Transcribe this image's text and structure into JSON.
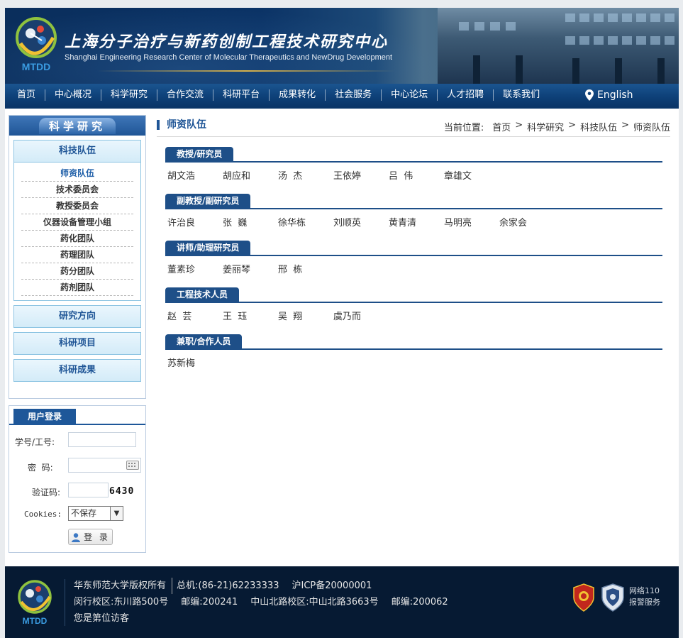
{
  "header": {
    "logo_text": "MTDD",
    "title_cn": "上海分子治疗与新药创制工程技术研究中心",
    "title_en": "Shanghai Engineering Research Center of Molecular Therapeutics and NewDrug Development"
  },
  "nav": {
    "items": [
      "首页",
      "中心概况",
      "科学研究",
      "合作交流",
      "科研平台",
      "成果转化",
      "社会服务",
      "中心论坛",
      "人才招聘",
      "联系我们"
    ],
    "english_label": "English"
  },
  "sidebar": {
    "heading": "科学研究",
    "categories": [
      {
        "label": "科技队伍"
      },
      {
        "label": "研究方向"
      },
      {
        "label": "科研项目"
      },
      {
        "label": "科研成果"
      }
    ],
    "subitems": [
      "师资队伍",
      "技术委员会",
      "教授委员会",
      "仪器设备管理小组",
      "药化团队",
      "药理团队",
      "药分团队",
      "药剂团队"
    ],
    "active_subitem": "师资队伍"
  },
  "login": {
    "tab_label": "用户登录",
    "username_label": "学号/工号:",
    "password_label": "密  码:",
    "captcha_label": "验证码:",
    "captcha_value": "6430",
    "cookies_label": "Cookies:",
    "cookies_selected": "不保存",
    "submit_label": "登 录"
  },
  "main": {
    "title": "师资队伍",
    "breadcrumb": {
      "prefix": "当前位置:",
      "items": [
        "首页",
        "科学研究",
        "科技队伍",
        "师资队伍"
      ],
      "separator": ">"
    },
    "sections": [
      {
        "title": "教授/研究员",
        "names": [
          "胡文浩",
          "胡应和",
          "汤  杰",
          "王依婷",
          "吕  伟",
          "章雄文"
        ]
      },
      {
        "title": "副教授/副研究员",
        "names": [
          "许治良",
          "张  巍",
          "徐华栋",
          "刘顺英",
          "黄青清",
          "马明亮",
          "余家会"
        ]
      },
      {
        "title": "讲师/助理研究员",
        "names": [
          "董素珍",
          "姜丽琴",
          "邢  栋"
        ]
      },
      {
        "title": "工程技术人员",
        "names": [
          "赵  芸",
          "王  珏",
          "吴  翔",
          "虞乃而"
        ]
      },
      {
        "title": "兼职/合作人员",
        "names": [
          "苏新梅"
        ]
      }
    ]
  },
  "footer": {
    "logo_text": "MTDD",
    "copyright": "华东师范大学版权所有",
    "phone": "总机:(86-21)62233333",
    "icp": "沪ICP备20000001",
    "campus1": "闵行校区:东川路500号",
    "zip1": "邮编:200241",
    "campus2": "中山北路校区:中山北路3663号",
    "zip2": "邮编:200062",
    "visitor": "您是第位访客",
    "police_line1": "网络110",
    "police_line2": "报警服务"
  },
  "colors": {
    "brand_blue": "#1e4f88",
    "nav_blue": "#0e4179",
    "footer_bg": "#061a33",
    "active_link": "#1f5fa8"
  }
}
